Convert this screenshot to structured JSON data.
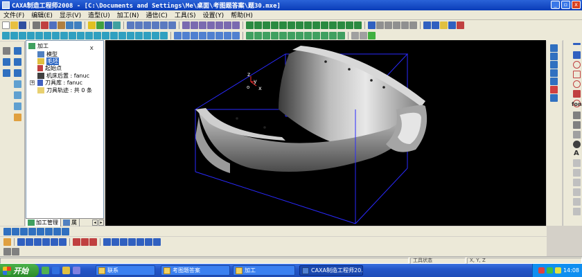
{
  "window": {
    "title": "CAXA制造工程师2008  - [C:\\Documents and Settings\\Me\\桌面\\考图题答案\\题30.mxe]",
    "minimize_label": "_",
    "restore_label": "▫",
    "close_label": "x"
  },
  "menu": {
    "items": [
      "文件(F)",
      "编辑(E)",
      "显示(V)",
      "造型(U)",
      "加工(N)",
      "通信(C)",
      "工具(S)",
      "设置(Y)",
      "帮助(H)"
    ]
  },
  "tree": {
    "close_label": "x",
    "root_label": "加工",
    "expand_symbol": "+",
    "items": [
      {
        "label": "模型"
      },
      {
        "label": "毛坯"
      },
      {
        "label": "起始点"
      },
      {
        "label": "机床后置 : fanuc"
      },
      {
        "label": "刀具库 : fanuc"
      },
      {
        "label": "刀具轨迹 : 共 0 条"
      }
    ],
    "tabs": [
      {
        "label": "加工管理"
      },
      {
        "label": "属"
      }
    ],
    "tab_arrow_left": "◂",
    "tab_arrow_right": "▸"
  },
  "viewport": {
    "axis_z": "z",
    "axis_y": "y",
    "axis_x": "x",
    "axis_o": "o"
  },
  "right_palette": {
    "fonts_label": "fon",
    "text_label": "A"
  },
  "statusbar": {
    "tool_state": "工具状态",
    "coords": "X, Y, Z"
  },
  "taskbar": {
    "start_label": "开始",
    "tasks": [
      {
        "label": "联系"
      },
      {
        "label": "考图题答案"
      },
      {
        "label": "加工"
      },
      {
        "label": "CAXA制造工程师20..."
      }
    ],
    "clock": "14:08"
  },
  "colors": {
    "titlebar": "#0a3cb8",
    "viewport_bg": "#000000",
    "blank_box": "#2a2aff",
    "selection": "#316ac5"
  }
}
